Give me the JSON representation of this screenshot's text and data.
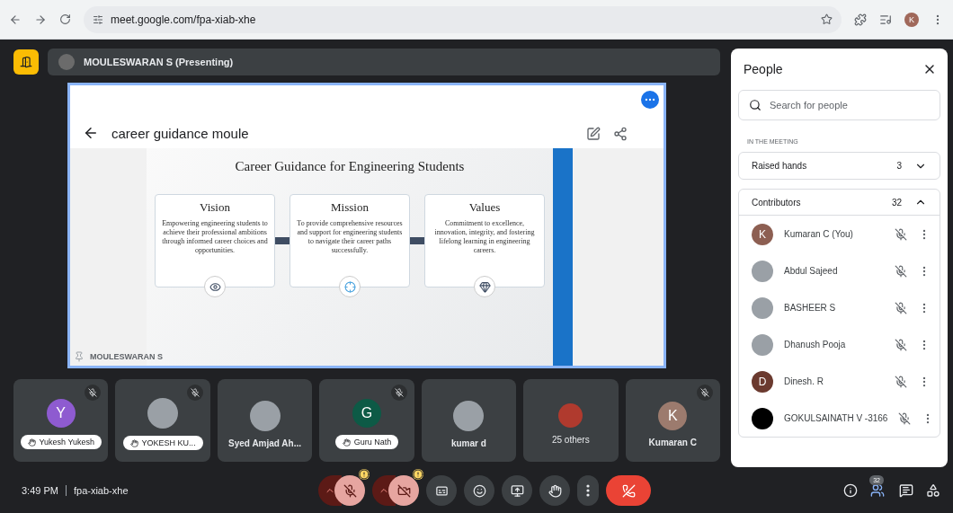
{
  "browser": {
    "url": "meet.google.com/fpa-xiab-xhe",
    "profile_initial": "K"
  },
  "presenter_bar": {
    "label": "MOULESWARAN S (Presenting)"
  },
  "presentation": {
    "doc_title": "career guidance moule",
    "slide_title": "Career Guidance for Engineering Students",
    "cards": [
      {
        "title": "Vision",
        "text": "Empowering engineering students to achieve their professional ambitions through informed career choices and opportunities.",
        "kind": "eye"
      },
      {
        "title": "Mission",
        "text": "To provide comprehensive resources and support for engineering students to navigate their career paths successfully.",
        "kind": "target"
      },
      {
        "title": "Values",
        "text": "Commitment to excellence, innovation, integrity, and fostering lifelong learning in engineering careers.",
        "kind": "gem"
      }
    ],
    "presenter_label": "MOULESWARAN S"
  },
  "tiles": [
    {
      "name": "Yukesh Yukesh",
      "kind": "letter",
      "initial": "Y",
      "color": "#8e5bd0",
      "muted": true,
      "hand_raised": true
    },
    {
      "name": "YOKESH KU...",
      "kind": "photo",
      "muted": true,
      "hand_raised": true
    },
    {
      "name": "Syed Amjad Ah...",
      "kind": "photo",
      "muted": false,
      "hand_raised": false
    },
    {
      "name": "Guru Nath",
      "kind": "letter",
      "initial": "G",
      "color": "#0d5a46",
      "muted": true,
      "hand_raised": true
    },
    {
      "name": "kumar d",
      "kind": "photo",
      "muted": false,
      "hand_raised": false
    },
    {
      "name": "25 others",
      "kind": "group",
      "muted": false,
      "hand_raised": false
    },
    {
      "name": "Kumaran C",
      "kind": "letter",
      "initial": "K",
      "color": "#9c7b6e",
      "muted": true,
      "hand_raised": false
    }
  ],
  "people_panel": {
    "title": "People",
    "search": {
      "placeholder": "Search for people"
    },
    "section_label": "IN THE MEETING",
    "groups": [
      {
        "label": "Raised hands",
        "count": "3",
        "expanded": false
      },
      {
        "label": "Contributors",
        "count": "32",
        "expanded": true
      }
    ],
    "participants": [
      {
        "name": "Kumaran C (You)",
        "kind": "letter",
        "initial": "K",
        "color": "#8d5f52"
      },
      {
        "name": "Abdul Sajeed",
        "kind": "photo"
      },
      {
        "name": "BASHEER S",
        "kind": "photo"
      },
      {
        "name": "Dhanush Pooja",
        "kind": "photo"
      },
      {
        "name": "Dinesh. R",
        "kind": "letter",
        "initial": "D",
        "color": "#6b3a2f"
      },
      {
        "name": "GOKULSAINATH V -3166",
        "kind": "letter",
        "color": "#000000"
      }
    ]
  },
  "bottom_bar": {
    "time": "3:49 PM",
    "meeting_code": "fpa-xiab-xhe",
    "mic_on": false,
    "camera_on": false,
    "people_count": "32"
  }
}
